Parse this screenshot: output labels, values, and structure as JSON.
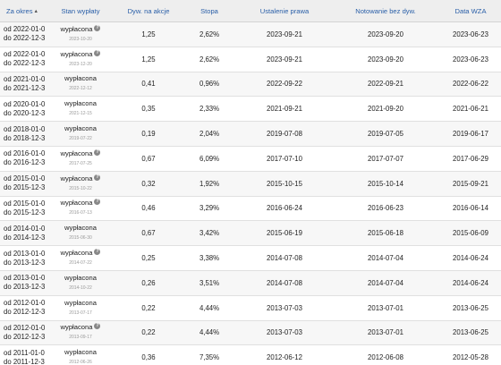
{
  "table": {
    "headers": [
      {
        "label": "Za okres"
      },
      {
        "label": "Stan wypłaty"
      },
      {
        "label": "Dyw. na akcje"
      },
      {
        "label": "Stopa"
      },
      {
        "label": "Ustalenie prawa"
      },
      {
        "label": "Notowanie bez dyw."
      },
      {
        "label": "Data WZA"
      }
    ],
    "rows": [
      {
        "from": "od 2022-01-01",
        "to": "do 2022-12-31",
        "status": "wypłacona",
        "status_date": "2023-10-20",
        "help_icon": true,
        "dividend": "1,25",
        "yield": "2,62%",
        "record_date": "2023-09-21",
        "ex_date": "2023-09-20",
        "agm_date": "2023-06-23"
      },
      {
        "from": "od 2022-01-01",
        "to": "do 2022-12-31",
        "status": "wypłacona",
        "status_date": "2023-12-20",
        "help_icon": true,
        "dividend": "1,25",
        "yield": "2,62%",
        "record_date": "2023-09-21",
        "ex_date": "2023-09-20",
        "agm_date": "2023-06-23"
      },
      {
        "from": "od 2021-01-01",
        "to": "do 2021-12-31",
        "status": "wypłacona",
        "status_date": "2022-12-12",
        "help_icon": false,
        "dividend": "0,41",
        "yield": "0,96%",
        "record_date": "2022-09-22",
        "ex_date": "2022-09-21",
        "agm_date": "2022-06-22"
      },
      {
        "from": "od 2020-01-01",
        "to": "do 2020-12-31",
        "status": "wypłacona",
        "status_date": "2021-12-15",
        "help_icon": false,
        "dividend": "0,35",
        "yield": "2,33%",
        "record_date": "2021-09-21",
        "ex_date": "2021-09-20",
        "agm_date": "2021-06-21"
      },
      {
        "from": "od 2018-01-01",
        "to": "do 2018-12-31",
        "status": "wypłacona",
        "status_date": "2019-07-22",
        "help_icon": false,
        "dividend": "0,19",
        "yield": "2,04%",
        "record_date": "2019-07-08",
        "ex_date": "2019-07-05",
        "agm_date": "2019-06-17"
      },
      {
        "from": "od 2016-01-01",
        "to": "do 2016-12-31",
        "status": "wypłacona",
        "status_date": "2017-07-25",
        "help_icon": true,
        "dividend": "0,67",
        "yield": "6,09%",
        "record_date": "2017-07-10",
        "ex_date": "2017-07-07",
        "agm_date": "2017-06-29"
      },
      {
        "from": "od 2015-01-01",
        "to": "do 2015-12-31",
        "status": "wypłacona",
        "status_date": "2015-10-22",
        "help_icon": true,
        "dividend": "0,32",
        "yield": "1,92%",
        "record_date": "2015-10-15",
        "ex_date": "2015-10-14",
        "agm_date": "2015-09-21"
      },
      {
        "from": "od 2015-01-01",
        "to": "do 2015-12-31",
        "status": "wypłacona",
        "status_date": "2016-07-13",
        "help_icon": true,
        "dividend": "0,46",
        "yield": "3,29%",
        "record_date": "2016-06-24",
        "ex_date": "2016-06-23",
        "agm_date": "2016-06-14"
      },
      {
        "from": "od 2014-01-01",
        "to": "do 2014-12-31",
        "status": "wypłacona",
        "status_date": "2015-06-30",
        "help_icon": false,
        "dividend": "0,67",
        "yield": "3,42%",
        "record_date": "2015-06-19",
        "ex_date": "2015-06-18",
        "agm_date": "2015-06-09"
      },
      {
        "from": "od 2013-01-01",
        "to": "do 2013-12-31",
        "status": "wypłacona",
        "status_date": "2014-07-22",
        "help_icon": true,
        "dividend": "0,25",
        "yield": "3,38%",
        "record_date": "2014-07-08",
        "ex_date": "2014-07-04",
        "agm_date": "2014-06-24"
      },
      {
        "from": "od 2013-01-01",
        "to": "do 2013-12-31",
        "status": "wypłacona",
        "status_date": "2014-10-22",
        "help_icon": false,
        "dividend": "0,26",
        "yield": "3,51%",
        "record_date": "2014-07-08",
        "ex_date": "2014-07-04",
        "agm_date": "2014-06-24"
      },
      {
        "from": "od 2012-01-01",
        "to": "do 2012-12-31",
        "status": "wypłacona",
        "status_date": "2013-07-17",
        "help_icon": false,
        "dividend": "0,22",
        "yield": "4,44%",
        "record_date": "2013-07-03",
        "ex_date": "2013-07-01",
        "agm_date": "2013-06-25"
      },
      {
        "from": "od 2012-01-01",
        "to": "do 2012-12-31",
        "status": "wypłacona",
        "status_date": "2013-09-17",
        "help_icon": true,
        "dividend": "0,22",
        "yield": "4,44%",
        "record_date": "2013-07-03",
        "ex_date": "2013-07-01",
        "agm_date": "2013-06-25"
      },
      {
        "from": "od 2011-01-01",
        "to": "do 2011-12-31",
        "status": "wypłacona",
        "status_date": "2012-06-26",
        "help_icon": false,
        "dividend": "0,36",
        "yield": "7,35%",
        "record_date": "2012-06-12",
        "ex_date": "2012-06-08",
        "agm_date": "2012-05-28"
      }
    ]
  }
}
